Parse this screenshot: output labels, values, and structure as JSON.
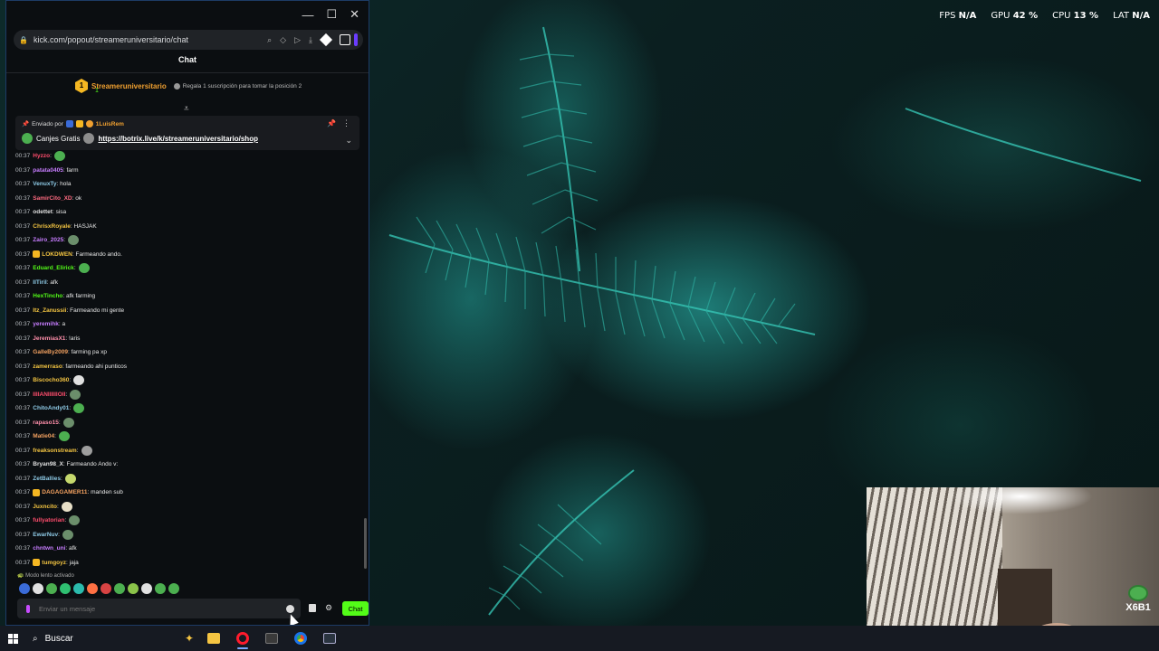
{
  "overlay": {
    "fps_label": "FPS",
    "fps": "N/A",
    "gpu_label": "GPU",
    "gpu": "42 %",
    "cpu_label": "CPU",
    "cpu": "13 %",
    "lat_label": "LAT",
    "lat": "N/A"
  },
  "browser": {
    "url": "kick.com/popout/streameruniversitario/chat"
  },
  "chat": {
    "header": "Chat",
    "leader": {
      "rank": "1",
      "name": "Streameruniversitario",
      "count": "1",
      "gift_text": "Regala 1 suscripción para tomar la posición 2"
    },
    "pinned": {
      "sent_by": "Enviado por",
      "author": "1LuisRem",
      "prefix": "Canjes Gratis",
      "link": "https://botrix.live/k/streameruniversitario/shop"
    },
    "messages": [
      {
        "time": "00:37",
        "user": "Hyzzo",
        "color": "#ff4d6d",
        "text": ":",
        "emote": "#4caf50"
      },
      {
        "time": "00:37",
        "user": "patata0405",
        "color": "#c77dff",
        "text": ": farm"
      },
      {
        "time": "00:37",
        "user": "VenuxTy",
        "color": "#8ecae6",
        "text": ": hola"
      },
      {
        "time": "00:37",
        "user": "SamirCito_XD",
        "color": "#ff6b81",
        "text": ": ok"
      },
      {
        "time": "00:37",
        "user": "odettet",
        "color": "#e0e0e0",
        "text": ": sisa"
      },
      {
        "time": "00:37",
        "user": "ChrisxRoyale",
        "color": "#f4c542",
        "text": ": HASJAK"
      },
      {
        "time": "00:37",
        "user": "Zairo_2025",
        "color": "#c77dff",
        "text": ":",
        "emote": "#6b8e6b"
      },
      {
        "time": "00:37",
        "user": "LOKDWEN",
        "color": "#f4c542",
        "text": ": Farmeando ando.",
        "badge": "#f5b722"
      },
      {
        "time": "00:37",
        "user": "Eduard_Elirick",
        "color": "#53fc18",
        "text": ":",
        "emote": "#4caf50"
      },
      {
        "time": "00:37",
        "user": "IITiriI",
        "color": "#8ecae6",
        "text": ": afk"
      },
      {
        "time": "00:37",
        "user": "HexTincho",
        "color": "#53fc18",
        "text": ": afk farming"
      },
      {
        "time": "00:37",
        "user": "Itz_Zanussii",
        "color": "#f4c542",
        "text": ": Farmeando mi gente"
      },
      {
        "time": "00:37",
        "user": "yeremihk",
        "color": "#c77dff",
        "text": ": a"
      },
      {
        "time": "00:37",
        "user": "JeremiasX1",
        "color": "#ff8fab",
        "text": ": !aris"
      },
      {
        "time": "00:37",
        "user": "GalleBy2009",
        "color": "#f4a261",
        "text": ": farming pa xp"
      },
      {
        "time": "00:37",
        "user": "zamerraso",
        "color": "#f4c542",
        "text": ": farmeando ahi punticos"
      },
      {
        "time": "00:37",
        "user": "Biscocho360",
        "color": "#f4c542",
        "text": ":",
        "emote": "#e0e0e0"
      },
      {
        "time": "00:37",
        "user": "IIIIANIIIIIIOII",
        "color": "#ff4d6d",
        "text": ":",
        "emote": "#6b8e6b"
      },
      {
        "time": "00:37",
        "user": "ChitoAndy01",
        "color": "#8ecae6",
        "text": ":",
        "emote": "#4caf50"
      },
      {
        "time": "00:37",
        "user": "rapaso15",
        "color": "#ff8fab",
        "text": ":",
        "emote": "#6b8e6b"
      },
      {
        "time": "00:37",
        "user": "Matie04",
        "color": "#f4a261",
        "text": ":",
        "emote": "#4caf50"
      },
      {
        "time": "00:37",
        "user": "freaksonstream",
        "color": "#f4c542",
        "text": ":",
        "emote": "#9e9e9e"
      },
      {
        "time": "00:37",
        "user": "Bryan98_X",
        "color": "#e0e0e0",
        "text": ": Farmeando Ando v:"
      },
      {
        "time": "00:37",
        "user": "ZetBallies",
        "color": "#8ecae6",
        "text": ":",
        "emote": "#c5d86d"
      },
      {
        "time": "00:37",
        "user": "DAGAGAMER11",
        "color": "#f4a261",
        "text": ": manden sub",
        "badge": "#f5b722"
      },
      {
        "time": "00:37",
        "user": "Juxncito",
        "color": "#f4c542",
        "text": ":",
        "emote": "#e8e0c8"
      },
      {
        "time": "00:37",
        "user": "fullyatorian",
        "color": "#ff4d6d",
        "text": ":",
        "emote": "#6b8e6b"
      },
      {
        "time": "00:37",
        "user": "EwarNuv",
        "color": "#8ecae6",
        "text": ":",
        "emote": "#6b8e6b"
      },
      {
        "time": "00:37",
        "user": "chntwn_uni",
        "color": "#c77dff",
        "text": ": afk"
      },
      {
        "time": "00:37",
        "user": "tumgoyz",
        "color": "#f4c542",
        "text": ": jaja",
        "badge": "#f5b722"
      }
    ],
    "slow_mode": "Modo lento activado",
    "input_placeholder": "Enviar un mensaje",
    "send_label": "Chat"
  },
  "emote_bar_colors": [
    "#3a6bd8",
    "#e0e0e0",
    "#4caf50",
    "#2fbf71",
    "#2bbbad",
    "#ff7043",
    "#d84343",
    "#4caf50",
    "#8bc34a",
    "#e0e0e0",
    "#4caf50",
    "#4caf50"
  ],
  "taskbar": {
    "search": "Buscar",
    "icons": [
      "windows-icon",
      "folder-icon",
      "opera-icon",
      "app-icon",
      "chrome-icon",
      "terminal-icon"
    ]
  },
  "webcam": {
    "badge_text": "X6B1"
  },
  "colors": {
    "accent": "#53fc18",
    "bg": "#0b0e11"
  }
}
